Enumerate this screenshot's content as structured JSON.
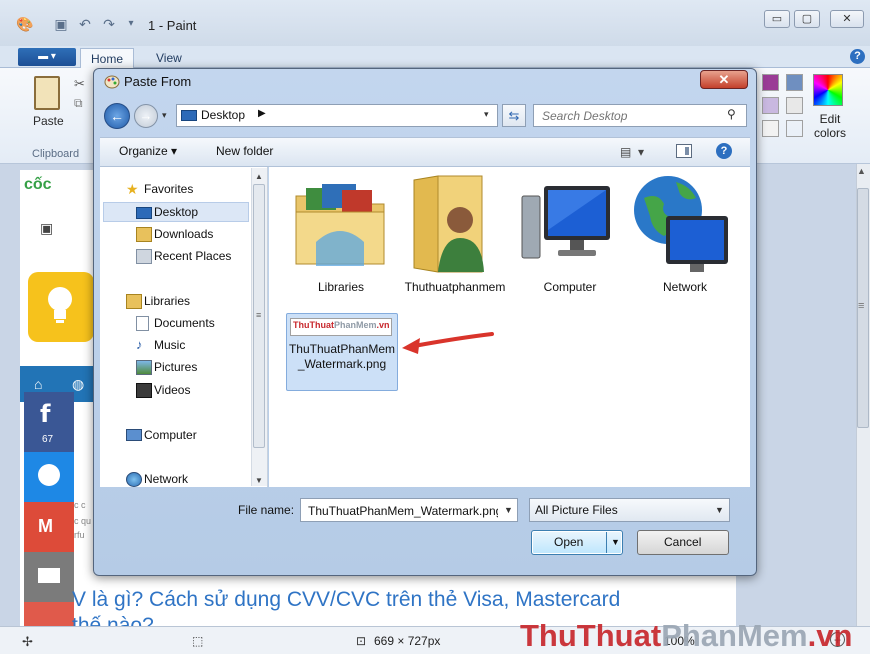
{
  "paint": {
    "title": "1 - Paint",
    "tabs": {
      "home": "Home",
      "view": "View"
    },
    "paste_label": "Paste",
    "clipboard_group": "Clipboard",
    "edit_colors": "Edit colors",
    "status_size": "669 × 727px",
    "status_zoom": "100%",
    "swatch_colors": [
      "#9a3b96",
      "#6f8fc0",
      "#c9b8e0",
      "#e8e8e8",
      "#f2f2f2"
    ]
  },
  "canvas_page": {
    "logo": "cốc",
    "headline": "V là gì? Cách sử dụng CVV/CVC trên thẻ Visa, Mastercard",
    "headline2": "thế nào?",
    "fb_count": "67",
    "tiny1": "c c",
    "tiny2": "c qu",
    "tiny3": "rfu"
  },
  "watermark": {
    "red": "ThuThuat",
    "gray": "PhanMem",
    "suffix": ".vn"
  },
  "dialog": {
    "title": "Paste From",
    "address": "Desktop",
    "search_placeholder": "Search Desktop",
    "toolbar": {
      "organize": "Organize",
      "new_folder": "New folder"
    },
    "nav": {
      "favorites": "Favorites",
      "desktop": "Desktop",
      "downloads": "Downloads",
      "recent_places": "Recent Places",
      "libraries": "Libraries",
      "documents": "Documents",
      "music": "Music",
      "pictures": "Pictures",
      "videos": "Videos",
      "computer": "Computer",
      "network": "Network"
    },
    "files": [
      {
        "label": "Libraries",
        "icon": "libraries-folder-icon"
      },
      {
        "label": "Thuthuatphanmem",
        "icon": "user-folder-icon"
      },
      {
        "label": "Computer",
        "icon": "computer-icon"
      },
      {
        "label": "Network",
        "icon": "network-icon"
      }
    ],
    "selected_file": "ThuThuatPhanMem_Watermark.png",
    "thumb_text": {
      "red": "ThuThuat",
      "gray": "PhanMem",
      "suffix": ".vn"
    },
    "file_name_label": "File name:",
    "file_name_value": "ThuThuatPhanMem_Watermark.png",
    "file_type": "All Picture Files",
    "open_label": "Open",
    "cancel_label": "Cancel"
  },
  "colors": {
    "accent_blue": "#2d6fc0",
    "annotation_arrow": "#d9342b",
    "watermark_red": "#c8282d"
  }
}
